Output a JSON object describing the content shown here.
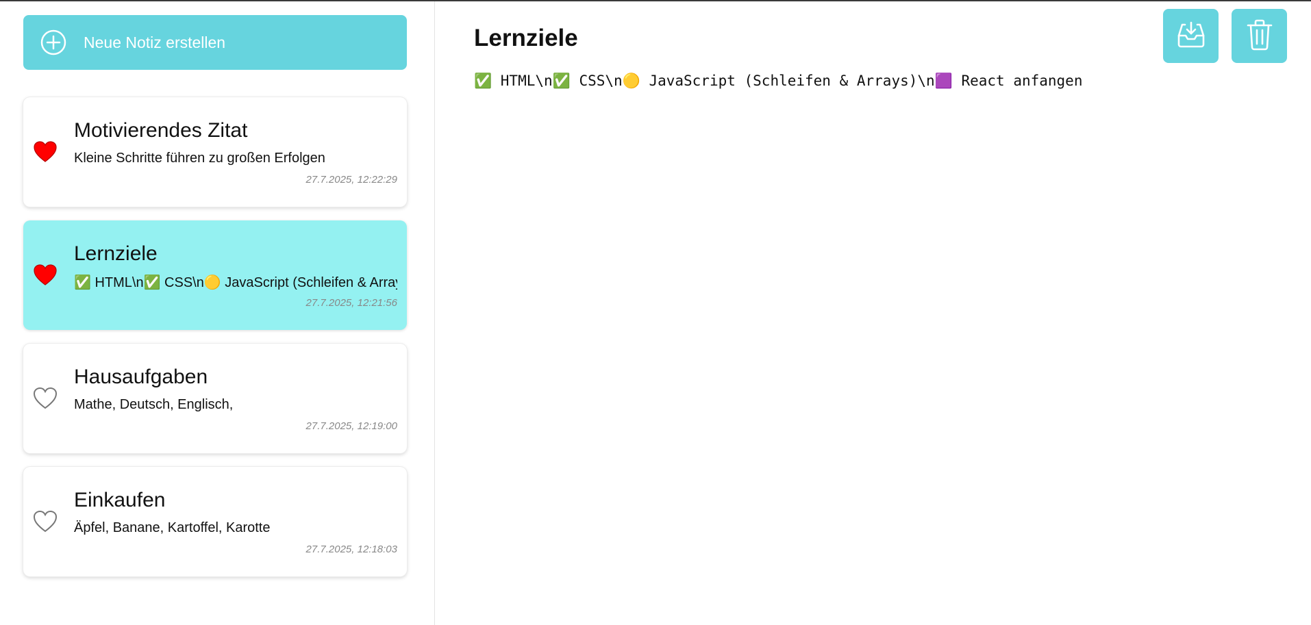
{
  "sidebar": {
    "new_note_label": "Neue Notiz erstellen",
    "notes": [
      {
        "title": "Motivierendes Zitat",
        "preview": "Kleine Schritte führen zu großen Erfolgen",
        "date": "27.7.2025, 12:22:29",
        "favorite": true,
        "active": false
      },
      {
        "title": "Lernziele",
        "preview": "✅ HTML\\n✅ CSS\\n🟡 JavaScript (Schleifen & Arrays)\\n🟪 React anfangen",
        "date": "27.7.2025, 12:21:56",
        "favorite": true,
        "active": true
      },
      {
        "title": "Hausaufgaben",
        "preview": "Mathe, Deutsch, Englisch,",
        "date": "27.7.2025, 12:19:00",
        "favorite": false,
        "active": false
      },
      {
        "title": "Einkaufen",
        "preview": "Äpfel, Banane, Kartoffel, Karotte",
        "date": "27.7.2025, 12:18:03",
        "favorite": false,
        "active": false
      }
    ]
  },
  "editor": {
    "title": "Lernziele",
    "body": "✅ HTML\\n✅ CSS\\n🟡 JavaScript (Schleifen & Arrays)\\n🟪 React anfangen"
  },
  "colors": {
    "accent": "#66d4de",
    "active_note": "#94f1f1",
    "heart_filled": "#ff0000",
    "heart_outline": "#777777"
  },
  "icons": {
    "new_note": "plus-circle-icon",
    "save": "inbox-download-icon",
    "delete": "trash-icon",
    "favorite_on": "heart-filled-icon",
    "favorite_off": "heart-outline-icon"
  }
}
